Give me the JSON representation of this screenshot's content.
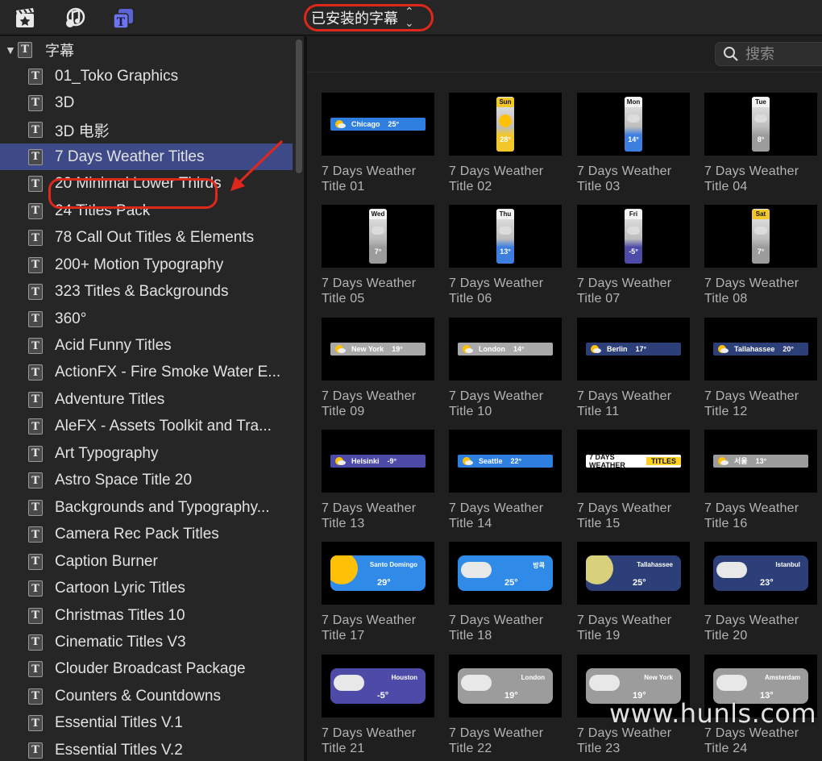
{
  "toolbar": {
    "icons": [
      "clapper-star-icon",
      "music-note-icon",
      "titles-icon"
    ],
    "browser_label": "已安装的字幕",
    "browser_chevron": "⌃⌄"
  },
  "search": {
    "placeholder": "搜索"
  },
  "sidebar": {
    "root_label": "字幕",
    "items": [
      "01_Toko Graphics",
      "3D",
      "3D 电影",
      "7 Days Weather Titles",
      "20 Minimal Lower Thirds",
      "24 Titles Pack",
      "78 Call Out Titles & Elements",
      "200+ Motion Typography",
      "323 Titles & Backgrounds",
      "360°",
      "Acid Funny Titles",
      "ActionFX - Fire Smoke Water E...",
      "Adventure Titles",
      "AleFX - Assets Toolkit and Tra...",
      "Art Typography",
      "Astro Space Title 20",
      "Backgrounds and Typography...",
      "Camera Rec Pack Titles",
      "Caption Burner",
      "Cartoon Lyric Titles",
      "Christmas Titles 10",
      "Cinematic Titles V3",
      "Clouder Broadcast Package",
      "Counters & Countdowns",
      "Essential Titles V.1",
      "Essential Titles V.2"
    ],
    "selected_index": 3
  },
  "tiles": [
    {
      "caption": "7 Days Weather Title 01",
      "kind": "bar",
      "text": "Chicago",
      "temp": "25°",
      "bg": "#2f7fe0"
    },
    {
      "caption": "7 Days Weather Title 02",
      "kind": "vcard",
      "text": "Sun",
      "temp": "28°",
      "bg": "#f2c72b"
    },
    {
      "caption": "7 Days Weather Title 03",
      "kind": "vcard",
      "text": "Mon",
      "temp": "14°",
      "bg": "#3d7fe0"
    },
    {
      "caption": "7 Days Weather Title 04",
      "kind": "vcard",
      "text": "Tue",
      "temp": "8°",
      "bg": "#9c9c9c"
    },
    {
      "caption": "7 Days Weather Title 05",
      "kind": "vcard",
      "text": "Wed",
      "temp": "7°",
      "bg": "#9c9c9c"
    },
    {
      "caption": "7 Days Weather Title 06",
      "kind": "vcard",
      "text": "Thu",
      "temp": "13°",
      "bg": "#3d7fe0"
    },
    {
      "caption": "7 Days Weather Title 07",
      "kind": "vcard",
      "text": "Fri",
      "temp": "-5°",
      "bg": "#4d4aa8"
    },
    {
      "caption": "7 Days Weather Title 08",
      "kind": "vcard",
      "text": "Sat",
      "temp": "7°",
      "bg": "#9c9c9c"
    },
    {
      "caption": "7 Days Weather Title 09",
      "kind": "bar",
      "text": "New York",
      "temp": "19°",
      "bg": "#a9a9a9"
    },
    {
      "caption": "7 Days Weather Title 10",
      "kind": "bar",
      "text": "London",
      "temp": "14°",
      "bg": "#a9a9a9"
    },
    {
      "caption": "7 Days Weather Title 11",
      "kind": "bar",
      "text": "Berlin",
      "temp": "17°",
      "bg": "#2d3f78"
    },
    {
      "caption": "7 Days Weather Title 12",
      "kind": "bar",
      "text": "Tallahassee",
      "temp": "20°",
      "bg": "#2d3f78"
    },
    {
      "caption": "7 Days Weather Title 13",
      "kind": "bar",
      "text": "Helsinki",
      "temp": "-9°",
      "bg": "#4d4aa8"
    },
    {
      "caption": "7 Days Weather Title 14",
      "kind": "bar",
      "text": "Seattle",
      "temp": "22°",
      "bg": "#2f7fe0"
    },
    {
      "caption": "7 Days Weather Title 15",
      "kind": "bar",
      "text": "7 DAYS WEATHER",
      "temp": "TITLES",
      "bg": "#ffffff"
    },
    {
      "caption": "7 Days Weather Title 16",
      "kind": "bar",
      "text": "서울",
      "temp": "13°",
      "bg": "#9c9c9c"
    },
    {
      "caption": "7 Days Weather Title 17",
      "kind": "rcard",
      "text": "Santo Domingo",
      "temp": "29°",
      "bg": "#2f8ae8"
    },
    {
      "caption": "7 Days Weather Title 18",
      "kind": "rcard",
      "text": "방콕",
      "temp": "25°",
      "bg": "#2f8ae8"
    },
    {
      "caption": "7 Days Weather Title 19",
      "kind": "rcard",
      "text": "Tallahassee",
      "temp": "25°",
      "bg": "#2d3f78"
    },
    {
      "caption": "7 Days Weather Title 20",
      "kind": "rcard",
      "text": "Istanbul",
      "temp": "23°",
      "bg": "#2d3f78"
    },
    {
      "caption": "7 Days Weather Title 21",
      "kind": "rcard",
      "text": "Houston",
      "temp": "-5°",
      "bg": "#4d4aa8"
    },
    {
      "caption": "7 Days Weather Title 22",
      "kind": "rcard",
      "text": "London",
      "temp": "19°",
      "bg": "#9c9c9c"
    },
    {
      "caption": "7 Days Weather Title 23",
      "kind": "rcard",
      "text": "New York",
      "temp": "19°",
      "bg": "#9c9c9c"
    },
    {
      "caption": "7 Days Weather Title 24",
      "kind": "rcard",
      "text": "Amsterdam",
      "temp": "13°",
      "bg": "#9c9c9c"
    }
  ],
  "watermark": "www.hunls.com",
  "colors": {
    "accent_red": "#e0271b",
    "selection": "#3e4a88"
  }
}
